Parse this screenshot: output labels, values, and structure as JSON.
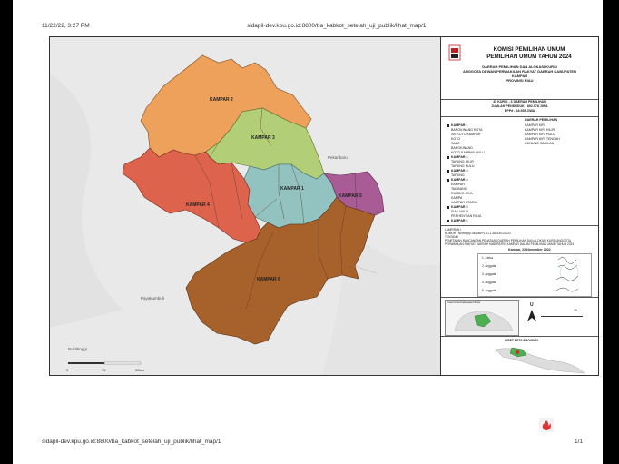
{
  "browser": {
    "datetime": "11/22/22, 3:27 PM",
    "url_top": "sidapil-dev.kpu.go.id:8800/ba_kabkot_setelah_uji_publik/lihat_map/1",
    "url_bottom": "sidapil-dev.kpu.go.id:8800/ba_kabkot_setelah_uji_publik/lihat_map/1",
    "page_count": "1/1"
  },
  "panel": {
    "title": "KOMISI PEMILIHAN UMUM\nPEMILIHAN UMUM TAHUN 2024",
    "sub_lines": [
      "DAERAH PEMILIHAN DAN ALOKASI KURSI",
      "ANGGOTA DEWAN PERWAKILAN RAKYAT DAERAH KABUPATEN",
      "KAMPAR",
      "PROVINSI RIAU"
    ],
    "stats": [
      "45 KURSI - 6 DAERAH PEMILIHAN",
      "JUMLAH PENDUDUK : 852.978 JIWA",
      "BPPd : 18.955 JIWA"
    ],
    "dapil_header": "DAERAH PEMILIHAN",
    "dapil_left": [
      {
        "name": "KAMPAR 1",
        "items": [
          "BANGKINANG KOTA",
          "XIII KOTO KAMPAR",
          "KOTO",
          "SALO",
          "BANGKINANG",
          "KOTO KAMPAR HULU"
        ]
      },
      {
        "name": "KAMPAR 2",
        "items": [
          "TAPUNG HILIR",
          "TAPUNG HULU"
        ]
      },
      {
        "name": "KAMPAR 3",
        "items": [
          "TAPUNG"
        ]
      },
      {
        "name": "KAMPAR 4",
        "items": [
          "KAMPAR",
          "TAMBANG",
          "RUMBIO JAYA",
          "KAMPA",
          "KAMPAR UTARA"
        ]
      },
      {
        "name": "KAMPAR 5",
        "items": [
          "SIAK HULU",
          "PERHENTIAN RAJA"
        ]
      },
      {
        "name": "KAMPAR 6",
        "items": []
      }
    ],
    "dapil_right": [
      "KAMPAR KIRI",
      "KAMPAR KIRI HILIR",
      "KAMPAR KIRI HULU",
      "KAMPAR KIRI TENGAH",
      "GUNUNG SAHILAN"
    ],
    "lampiran": [
      "LAMPIRAN I",
      "NOMOR : Nomor/pp.04/Aas/PL.01.1-BA/1401/2022",
      "TENTANG",
      "PENETAPAN RANCANGAN PENATAAN DAERAH PEMILIHAN DAN ALOKASI KURSI ANGGOTA",
      "PERWAKILAN RAKYAT DAERAH KABUPATEN KAMPAR DALAM PEMILIHAN UMUM TAHUN 2024"
    ],
    "date_line": "Kampar, 22 November 2022",
    "signers": [
      {
        "no": "1.",
        "name": "Ketua",
        "role": "Ketua"
      },
      {
        "no": "2.",
        "name": "Anggota",
        "role": "Anggota"
      },
      {
        "no": "3.",
        "name": "Anggota",
        "role": "Anggota"
      },
      {
        "no": "4.",
        "name": "Anggota",
        "role": "Anggota"
      },
      {
        "no": "5.",
        "name": "Anggota",
        "role": "Anggota"
      }
    ],
    "inset1_title": "Inset Peta Kabupaten/Kota",
    "scale_value": "30",
    "north": "U",
    "inset2_title": "INSET PETA PROVINSI"
  },
  "map": {
    "labels": [
      {
        "key": "kampar2",
        "text": "KAMPAR 2"
      },
      {
        "key": "kampar3",
        "text": "KAMPAR 3"
      },
      {
        "key": "kampar1",
        "text": "KAMPAR 1"
      },
      {
        "key": "kampar4",
        "text": "KAMPAR 4"
      },
      {
        "key": "kampar5",
        "text": "KAMPAR 5"
      },
      {
        "key": "kampar6",
        "text": "KAMPAR 6"
      }
    ],
    "place_names": [
      "Pekanbaru",
      "Payakumbuh",
      "Bukittinggi"
    ],
    "scale_labels": [
      "0",
      "15",
      "30km"
    ],
    "colors": {
      "kampar1": "#93c3c1",
      "kampar2": "#eea15b",
      "kampar3": "#b2cf78",
      "kampar4": "#dd634c",
      "kampar5": "#a95b96",
      "kampar6": "#a7612a",
      "background": "#e9e9e9"
    }
  }
}
